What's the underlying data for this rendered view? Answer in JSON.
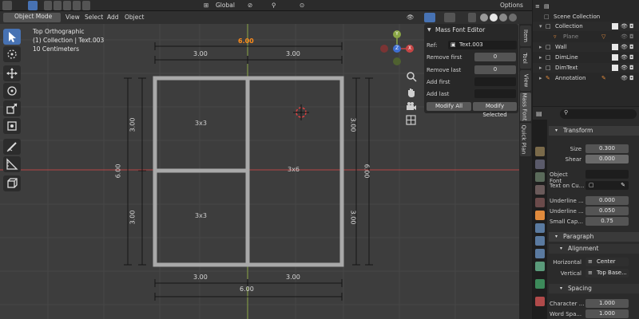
{
  "header": {
    "mode": "Object Mode",
    "menus": [
      "View",
      "Select",
      "Add",
      "Object"
    ],
    "orientation": "Global",
    "options": "Options"
  },
  "viewport": {
    "info": [
      "Top Orthographic",
      "(1) Collection | Text.003",
      "10 Centimeters"
    ],
    "dims": {
      "top_total": "6.00",
      "top_left": "3.00",
      "top_right": "3.00",
      "bottom_left": "3.00",
      "bottom_right": "3.00",
      "bottom_total": "6.00",
      "left_upper": "3.00",
      "left_lower": "3.00",
      "left_total": "6.00",
      "right_inner": "6.00"
    },
    "cells": {
      "top_left": "3x3",
      "bottom_left": "3x3",
      "right": "3x6"
    },
    "gizmo": {
      "x": "X",
      "y": "Y",
      "z": "Z"
    }
  },
  "mass_font_editor": {
    "title": "Mass Font Editor",
    "ref_label": "Ref:",
    "ref_value": "Text.003",
    "remove_first_label": "Remove first",
    "remove_first_value": "0",
    "remove_last_label": "Remove last",
    "remove_last_value": "0",
    "add_first_label": "Add first",
    "add_last_label": "Add last",
    "modify_all": "Modify All",
    "modify_selected": "Modify Selected"
  },
  "side_tabs": [
    "Item",
    "Tool",
    "View",
    "Mass Font",
    "Quick Plan"
  ],
  "outliner": {
    "root": "Scene Collection",
    "items": [
      {
        "name": "Collection"
      },
      {
        "name": "Plane"
      },
      {
        "name": "Wall"
      },
      {
        "name": "DimLine"
      },
      {
        "name": "DimText"
      },
      {
        "name": "Annotation"
      }
    ]
  },
  "properties": {
    "transform": "Transform",
    "size_label": "Size",
    "size_value": "0.300",
    "shear_label": "Shear",
    "shear_value": "0.000",
    "object_font_label": "Object Font",
    "text_on_curve_label": "Text on Cu...",
    "underline_pos_label": "Underline ...",
    "underline_pos_value": "0.000",
    "underline_thick_label": "Underline ...",
    "underline_thick_value": "0.050",
    "small_caps_label": "Small Cap...",
    "small_caps_value": "0.75",
    "paragraph": "Paragraph",
    "alignment": "Alignment",
    "horizontal_label": "Horizontal",
    "horizontal_value": "Center",
    "vertical_label": "Vertical",
    "vertical_value": "Top Base...",
    "spacing": "Spacing",
    "char_spacing_label": "Character ...",
    "char_spacing_value": "1.000",
    "word_spacing_label": "Word Spa...",
    "word_spacing_value": "1.000"
  },
  "colors": {
    "accent": "#4772b3",
    "dim_highlight": "#ff8c1a",
    "axis_x": "#c64545",
    "axis_y": "#9ab54b"
  }
}
